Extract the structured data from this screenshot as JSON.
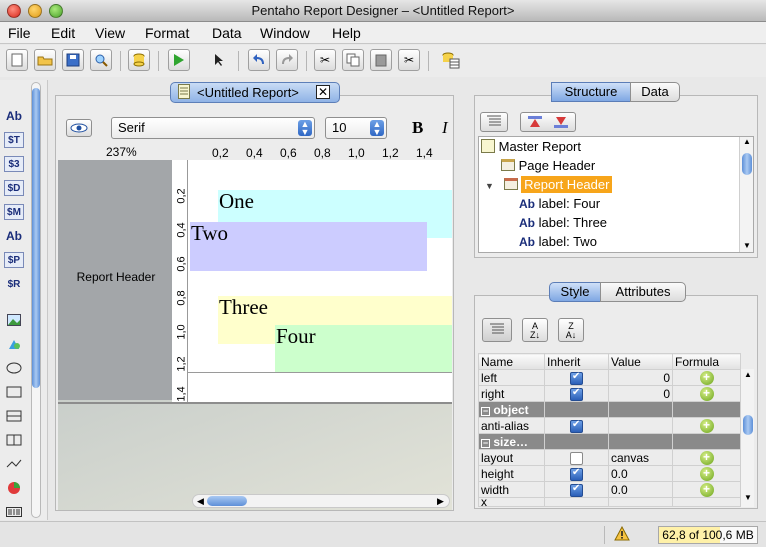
{
  "window": {
    "title": "Pentaho Report Designer – <Untitled Report>"
  },
  "menubar": {
    "items": [
      "File",
      "Edit",
      "View",
      "Format",
      "Data",
      "Window",
      "Help"
    ]
  },
  "toolbar": {
    "buttons": [
      "new-icon",
      "open-icon",
      "save-icon",
      "preview-search-icon",
      "database-icon",
      "run-icon",
      "select-arrow-icon",
      "undo-icon",
      "redo-icon",
      "cut-icon",
      "copy-icon",
      "paste-icon",
      "delete-icon",
      "data-source-icon"
    ]
  },
  "palette": {
    "items": [
      "Ab",
      "$T",
      "$3",
      "$D",
      "$M",
      "Ab",
      "$P",
      "$R"
    ]
  },
  "editor": {
    "tab_title": "<Untitled Report>",
    "font_family": "Serif",
    "font_size": "10",
    "bold_label": "B",
    "italic_label": "I",
    "zoom": "237%",
    "ruler_h": [
      "0,2",
      "0,4",
      "0,6",
      "0,8",
      "1,0",
      "1,2",
      "1,4"
    ],
    "ruler_v": [
      "0,2",
      "0,4",
      "0,6",
      "0,8",
      "1,0",
      "1,2",
      "1,4"
    ],
    "band_label": "Report Header",
    "labels": {
      "one": "One",
      "two": "Two",
      "three": "Three",
      "four": "Four"
    }
  },
  "structure": {
    "tabs": [
      "Structure",
      "Data"
    ],
    "tree": [
      {
        "text": "Master Report"
      },
      {
        "text": "Page Header"
      },
      {
        "text": "Report Header",
        "selected": true
      },
      {
        "text": "label: Four"
      },
      {
        "text": "label: Three"
      },
      {
        "text": "label: Two"
      }
    ],
    "selected_color": "#f7a51a"
  },
  "properties": {
    "tabs": [
      "Style",
      "Attributes"
    ],
    "columns": [
      "Name",
      "Inherit",
      "Value",
      "Formula"
    ],
    "rows": [
      {
        "name": "left",
        "inherit": true,
        "value": "0"
      },
      {
        "name": "right",
        "inherit": true,
        "value": "0"
      },
      {
        "group": "object"
      },
      {
        "name": "anti-alias",
        "inherit": true,
        "value": ""
      },
      {
        "group": "size…"
      },
      {
        "name": "layout",
        "inherit": false,
        "value": "canvas"
      },
      {
        "name": "height",
        "inherit": true,
        "value": "0.0"
      },
      {
        "name": "width",
        "inherit": true,
        "value": "0.0"
      },
      {
        "name": "x",
        "inherit": true,
        "value": ""
      }
    ]
  },
  "status": {
    "memory": "62,8 of  100,6 MB",
    "warning_icon": "warning-icon"
  },
  "colors": {
    "one_bg": "#ccffff",
    "two_bg": "#ccccff",
    "three_bg": "#ffffcc",
    "four_bg": "#ccffcc"
  }
}
